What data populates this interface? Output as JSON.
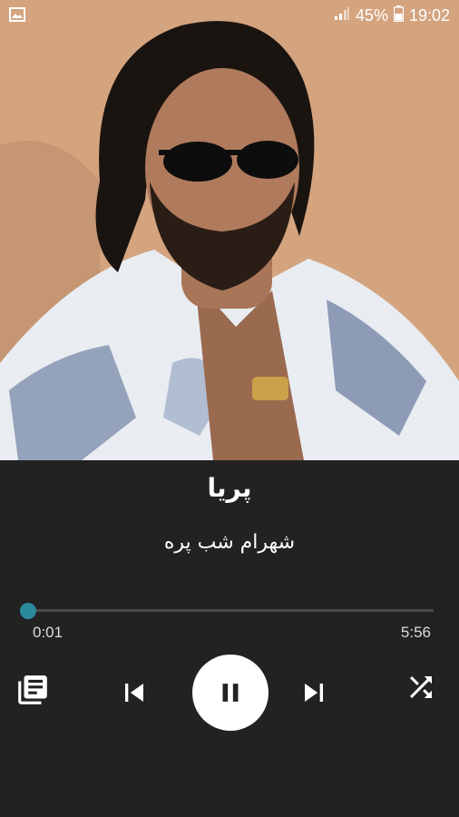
{
  "status_bar": {
    "battery": "45%",
    "time": "19:02",
    "icons": [
      "image-icon",
      "signal-icon",
      "battery-icon"
    ]
  },
  "album_art": {
    "description_icon": "portrait-image"
  },
  "track": {
    "title": "پریا",
    "artist": "شهرام شب پره"
  },
  "progress": {
    "elapsed": "0:01",
    "total": "5:56",
    "fraction": 0.003
  },
  "controls": {
    "playlist_icon": "playlist-icon",
    "previous_icon": "skip-previous-icon",
    "play_pause_icon": "pause-icon",
    "next_icon": "skip-next-icon",
    "shuffle_icon": "shuffle-icon"
  },
  "colors": {
    "panel_bg": "#222222",
    "accent": "#2b8a9e",
    "text": "#ffffff"
  }
}
